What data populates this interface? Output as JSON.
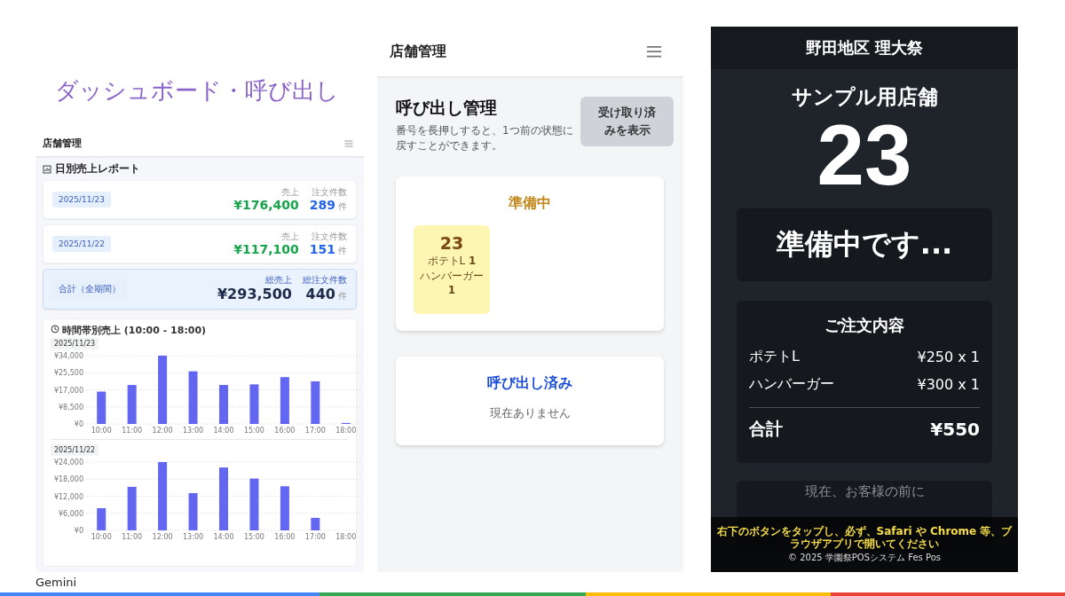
{
  "slide": {
    "title": "ダッシュボード・呼び出し",
    "footer": "Gemini"
  },
  "dashboard": {
    "header": "店舗管理",
    "report_title": "日別売上レポート",
    "days": [
      {
        "kind": "day",
        "date": "2025/11/23",
        "sales_label": "売上",
        "sales": "¥176,400",
        "count_label": "注文件数",
        "count": "289",
        "unit": "件"
      },
      {
        "kind": "day",
        "date": "2025/11/22",
        "sales_label": "売上",
        "sales": "¥117,100",
        "count_label": "注文件数",
        "count": "151",
        "unit": "件"
      },
      {
        "kind": "total",
        "date": "合計（全期間）",
        "sales_label": "総売上",
        "sales": "¥293,500",
        "count_label": "総注文件数",
        "count": "440",
        "unit": "件"
      }
    ],
    "hourly_title": "時間帯別売上 (10:00 - 18:00)",
    "charts": [
      {
        "date": "2025/11/23",
        "chart_data": {
          "type": "bar",
          "grid": true,
          "categories": [
            "10:00",
            "11:00",
            "12:00",
            "13:00",
            "14:00",
            "15:00",
            "16:00",
            "17:00",
            "18:00"
          ],
          "ylim": [
            0,
            34000
          ],
          "yticks": [
            {
              "value": 0,
              "label": "¥0"
            },
            {
              "value": 8500,
              "label": "¥8,500"
            },
            {
              "value": 17000,
              "label": "¥17,000"
            },
            {
              "value": 25500,
              "label": "¥25,500"
            },
            {
              "value": 34000,
              "label": "¥34,000"
            }
          ],
          "series": [
            {
              "color": "#6366f1",
              "values": [
                16100,
                19400,
                34000,
                26200,
                19400,
                19700,
                23300,
                21200,
                500
              ]
            }
          ]
        }
      },
      {
        "date": "2025/11/22",
        "chart_data": {
          "type": "bar",
          "grid": true,
          "categories": [
            "10:00",
            "11:00",
            "12:00",
            "13:00",
            "14:00",
            "15:00",
            "16:00",
            "17:00",
            "18:00"
          ],
          "ylim": [
            0,
            24000
          ],
          "yticks": [
            {
              "value": 0,
              "label": "¥0"
            },
            {
              "value": 6000,
              "label": "¥6,000"
            },
            {
              "value": 12000,
              "label": "¥12,000"
            },
            {
              "value": 18000,
              "label": "¥18,000"
            },
            {
              "value": 24000,
              "label": "¥24,000"
            }
          ],
          "series": [
            {
              "color": "#6366f1",
              "values": [
                7800,
                15300,
                24000,
                13100,
                22100,
                18200,
                15500,
                4400,
                0
              ]
            }
          ]
        }
      }
    ]
  },
  "calls": {
    "header": "店舗管理",
    "title": "呼び出し管理",
    "description": "番号を長押しすると、1つ前の状態に戻すことができます。",
    "toggle_button": "受け取り済みを表示",
    "sections": [
      {
        "kind": "preparing",
        "title": "準備中",
        "tickets": [
          {
            "number": "23",
            "items": [
              {
                "name": "ポテトL",
                "qty": "1"
              },
              {
                "name": "ハンバーガー",
                "qty": "1"
              }
            ]
          }
        ]
      },
      {
        "kind": "called",
        "title": "呼び出し済み",
        "empty_text": "現在ありません"
      }
    ]
  },
  "display": {
    "header": "野田地区 理大祭",
    "store": "サンプル用店舗",
    "number": "23",
    "status": "準備中です...",
    "order_title": "ご注文内容",
    "items": [
      {
        "name": "ポテトL",
        "price": "¥250 x 1"
      },
      {
        "name": "ハンバーガー",
        "price": "¥300 x 1"
      }
    ],
    "total_label": "合計",
    "total": "¥550",
    "next_card_text": "現在、お客様の前に",
    "notice": "右下のボタンをタップし、必ず、Safari や Chrome 等、ブラウザアプリで開いてください",
    "copyright": "© 2025 学園祭POSシステム Fes Pos"
  }
}
